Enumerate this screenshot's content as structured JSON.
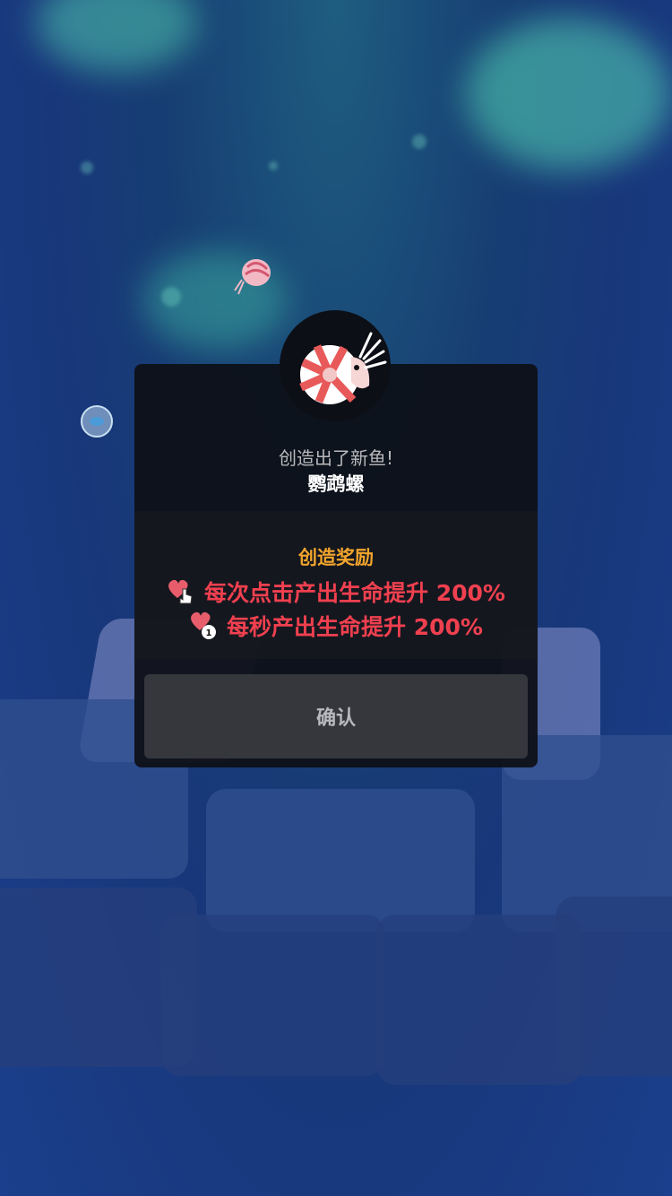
{
  "modal": {
    "subtitle": "创造出了新鱼!",
    "fish_name": "鹦鹉螺",
    "reward_title": "创造奖励",
    "rewards": [
      {
        "icon": "heart-tap-icon",
        "text": "每次点击产出生命提升 200%"
      },
      {
        "icon": "heart-clock-icon",
        "text": "每秒产出生命提升 200%"
      }
    ],
    "confirm_label": "确认",
    "avatar_icon": "nautilus-icon"
  },
  "colors": {
    "reward_title": "#f2a52c",
    "reward_text": "#f0404f",
    "modal_bg": "#0d0f16",
    "button_bg": "#35373d"
  }
}
